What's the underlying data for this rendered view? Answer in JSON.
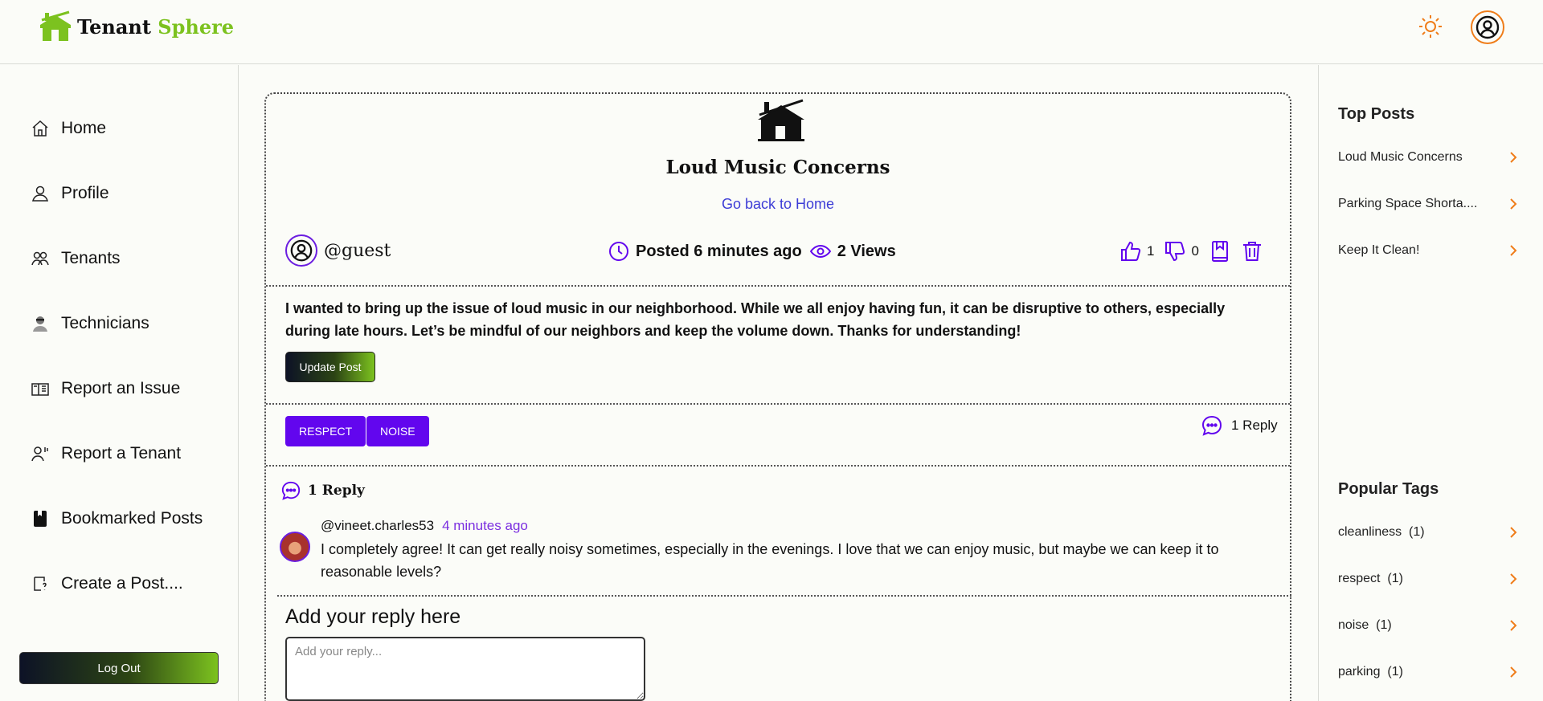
{
  "brand": {
    "name_primary": "Tenant",
    "name_accent": "Sphere",
    "accent_color": "#7cc21f"
  },
  "header": {
    "theme_icon": "sun-icon",
    "account_icon": "user-circle-icon"
  },
  "sidebar": {
    "items": [
      {
        "label": "Home",
        "icon": "home-icon"
      },
      {
        "label": "Profile",
        "icon": "user-icon"
      },
      {
        "label": "Tenants",
        "icon": "users-icon"
      },
      {
        "label": "Technicians",
        "icon": "technician-icon"
      },
      {
        "label": "Report an Issue",
        "icon": "report-issue-icon"
      },
      {
        "label": "Report a Tenant",
        "icon": "report-tenant-icon"
      },
      {
        "label": "Bookmarked Posts",
        "icon": "bookmark-icon"
      },
      {
        "label": "Create a Post....",
        "icon": "create-post-icon"
      }
    ],
    "logout_label": "Log Out"
  },
  "post": {
    "title": "Loud Music Concerns",
    "back_link": "Go back to Home",
    "author": "@guest",
    "posted": "Posted 6 minutes ago",
    "views": "2 Views",
    "likes": "1",
    "dislikes": "0",
    "body": "I wanted to bring up the issue of loud music in our neighborhood. While we all enjoy having fun, it can be disruptive to others, especially during late hours. Let’s be mindful of our neighbors and keep the volume down. Thanks for understanding!",
    "update_label": "Update Post",
    "tags": [
      "RESPECT",
      "NOISE"
    ],
    "reply_count_label": "1 Reply"
  },
  "replies": {
    "heading": "1 Reply",
    "items": [
      {
        "user": "@vineet.charles53",
        "time": "4 minutes ago",
        "text": "I completely agree! It can get really noisy sometimes, especially in the evenings. I love that we can enjoy music, but maybe we can keep it to reasonable levels?"
      }
    ]
  },
  "reply_form": {
    "title": "Add your reply here",
    "placeholder": "Add your reply..."
  },
  "right_panel": {
    "top_posts_title": "Top Posts",
    "top_posts": [
      "Loud Music Concerns",
      "Parking Space Shorta....",
      "Keep It Clean!"
    ],
    "popular_tags_title": "Popular Tags",
    "popular_tags": [
      {
        "name": "cleanliness",
        "count": "(1)"
      },
      {
        "name": "respect",
        "count": "(1)"
      },
      {
        "name": "noise",
        "count": "(1)"
      },
      {
        "name": "parking",
        "count": "(1)"
      }
    ]
  },
  "colors": {
    "purple": "#6206ee",
    "orange": "#ef7d1a",
    "link_blue": "#3d3dd6"
  }
}
